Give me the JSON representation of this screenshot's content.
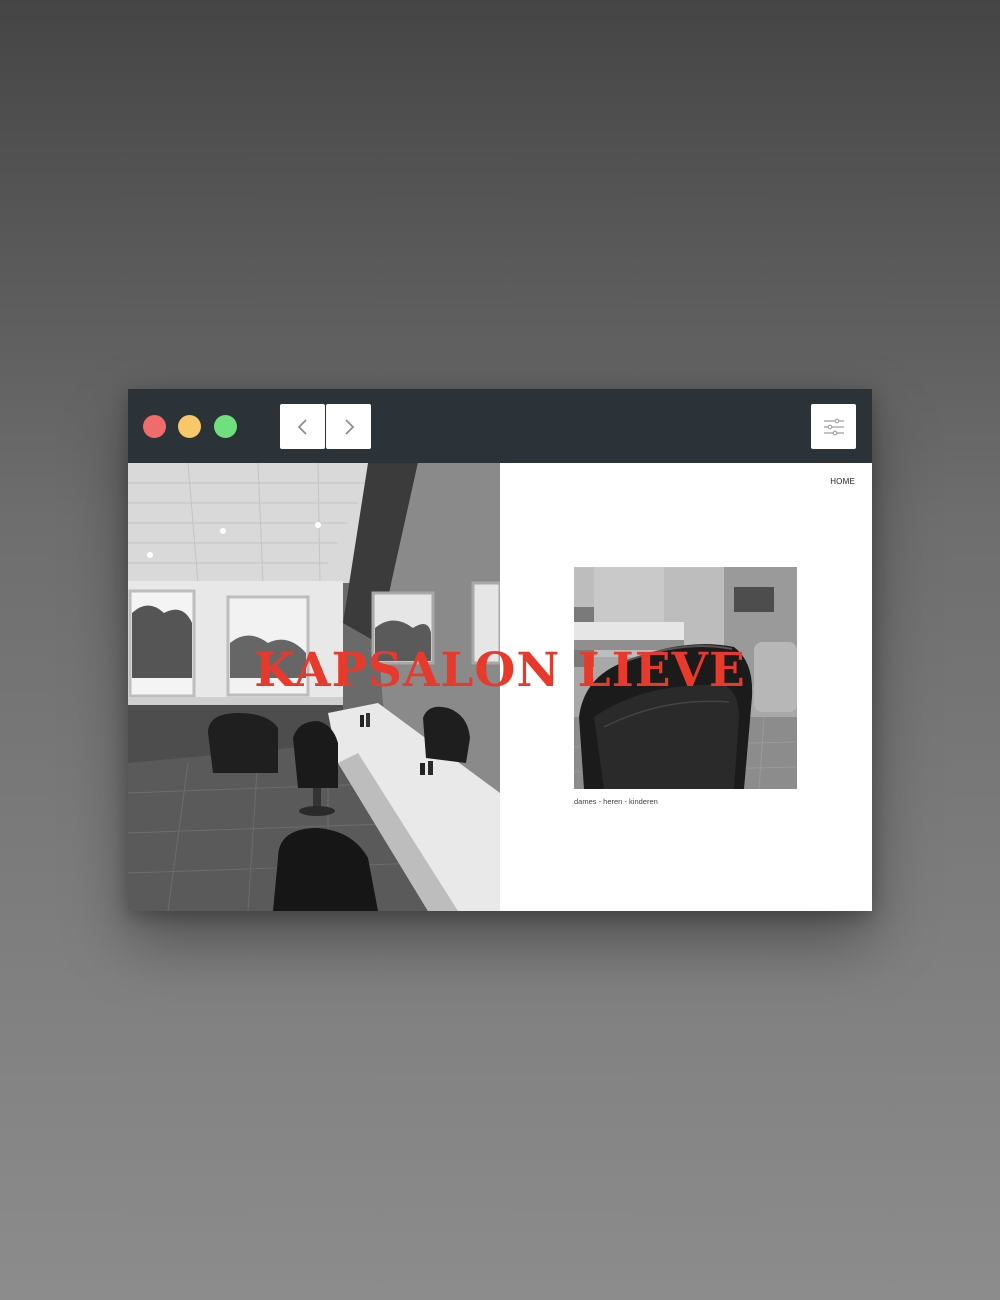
{
  "browser": {
    "back_icon": "chevron-left-icon",
    "forward_icon": "chevron-right-icon",
    "menu_icon": "sliders-icon",
    "colors": {
      "titlebar": "#2b3339",
      "close": "#f26b6b",
      "minimize": "#f7c76a",
      "maximize": "#6fe07d"
    }
  },
  "site": {
    "nav": {
      "home_label": "HOME"
    },
    "title": "KAPSALON LIEVE",
    "caption": "dames - heren - kinderen",
    "accent_color": "#e83a2c"
  }
}
